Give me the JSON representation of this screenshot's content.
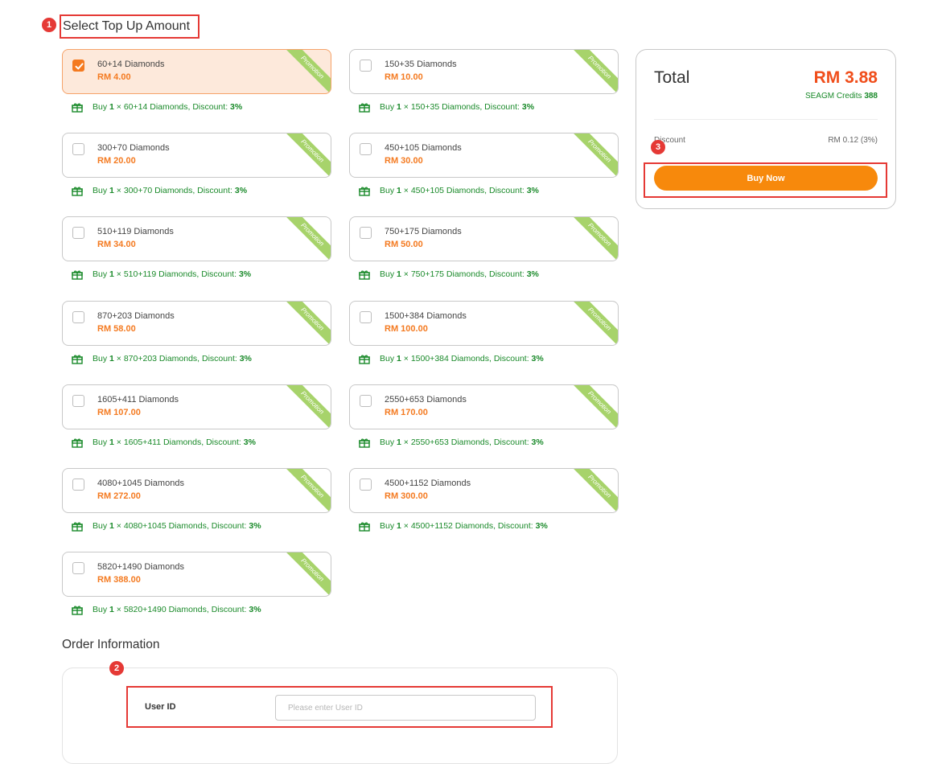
{
  "header": {
    "title": "Select Top Up Amount"
  },
  "markers": [
    "1",
    "2",
    "3"
  ],
  "packages": [
    {
      "name": "60+14 Diamonds",
      "price": "RM 4.00",
      "ribbon": "Promotion",
      "selected": true,
      "promo_prefix": "Buy ",
      "promo_qty": "1",
      "promo_mid": " × 60+14 Diamonds, Discount: ",
      "promo_discount": "3%"
    },
    {
      "name": "150+35 Diamonds",
      "price": "RM 10.00",
      "ribbon": "Promotion",
      "selected": false,
      "promo_prefix": "Buy ",
      "promo_qty": "1",
      "promo_mid": " × 150+35 Diamonds, Discount: ",
      "promo_discount": "3%"
    },
    {
      "name": "300+70 Diamonds",
      "price": "RM 20.00",
      "ribbon": "Promotion",
      "selected": false,
      "promo_prefix": "Buy ",
      "promo_qty": "1",
      "promo_mid": " × 300+70 Diamonds, Discount: ",
      "promo_discount": "3%"
    },
    {
      "name": "450+105 Diamonds",
      "price": "RM 30.00",
      "ribbon": "Promotion",
      "selected": false,
      "promo_prefix": "Buy ",
      "promo_qty": "1",
      "promo_mid": " × 450+105 Diamonds, Discount: ",
      "promo_discount": "3%"
    },
    {
      "name": "510+119 Diamonds",
      "price": "RM 34.00",
      "ribbon": "Promotion",
      "selected": false,
      "promo_prefix": "Buy ",
      "promo_qty": "1",
      "promo_mid": " × 510+119 Diamonds, Discount: ",
      "promo_discount": "3%"
    },
    {
      "name": "750+175 Diamonds",
      "price": "RM 50.00",
      "ribbon": "Promotion",
      "selected": false,
      "promo_prefix": "Buy ",
      "promo_qty": "1",
      "promo_mid": " × 750+175 Diamonds, Discount: ",
      "promo_discount": "3%"
    },
    {
      "name": "870+203 Diamonds",
      "price": "RM 58.00",
      "ribbon": "Promotion",
      "selected": false,
      "promo_prefix": "Buy ",
      "promo_qty": "1",
      "promo_mid": " × 870+203 Diamonds, Discount: ",
      "promo_discount": "3%"
    },
    {
      "name": "1500+384 Diamonds",
      "price": "RM 100.00",
      "ribbon": "Promotion",
      "selected": false,
      "promo_prefix": "Buy ",
      "promo_qty": "1",
      "promo_mid": " × 1500+384 Diamonds, Discount: ",
      "promo_discount": "3%"
    },
    {
      "name": "1605+411 Diamonds",
      "price": "RM 107.00",
      "ribbon": "Promotion",
      "selected": false,
      "promo_prefix": "Buy ",
      "promo_qty": "1",
      "promo_mid": " × 1605+411 Diamonds, Discount: ",
      "promo_discount": "3%"
    },
    {
      "name": "2550+653 Diamonds",
      "price": "RM 170.00",
      "ribbon": "Promotion",
      "selected": false,
      "promo_prefix": "Buy ",
      "promo_qty": "1",
      "promo_mid": " × 2550+653 Diamonds, Discount: ",
      "promo_discount": "3%"
    },
    {
      "name": "4080+1045 Diamonds",
      "price": "RM 272.00",
      "ribbon": "Promotion",
      "selected": false,
      "promo_prefix": "Buy ",
      "promo_qty": "1",
      "promo_mid": " × 4080+1045 Diamonds, Discount: ",
      "promo_discount": "3%"
    },
    {
      "name": "4500+1152 Diamonds",
      "price": "RM 300.00",
      "ribbon": "Promotion",
      "selected": false,
      "promo_prefix": "Buy ",
      "promo_qty": "1",
      "promo_mid": " × 4500+1152 Diamonds, Discount: ",
      "promo_discount": "3%"
    },
    {
      "name": "5820+1490 Diamonds",
      "price": "RM 388.00",
      "ribbon": "Promotion",
      "selected": false,
      "promo_prefix": "Buy ",
      "promo_qty": "1",
      "promo_mid": " × 5820+1490 Diamonds, Discount: ",
      "promo_discount": "3%"
    }
  ],
  "summary": {
    "total_label": "Total",
    "total_price": "RM 3.88",
    "credits_label": "SEAGM Credits ",
    "credits_value": "388",
    "discount_label": "Discount",
    "discount_value": "RM 0.12 (3%)",
    "buy_label": "Buy Now"
  },
  "order": {
    "title": "Order Information",
    "user_id_label": "User ID",
    "user_id_value": "",
    "user_id_placeholder": "Please enter User ID"
  },
  "colors": {
    "accent": "#f47a20",
    "price": "#f04e1b",
    "buy_button": "#f7890c",
    "promo_text": "#1a8a2a",
    "ribbon": "#a7d36b",
    "marker": "#e53935"
  },
  "icons": {
    "promo": "gift-icon",
    "checkbox_checked": "check-icon"
  }
}
